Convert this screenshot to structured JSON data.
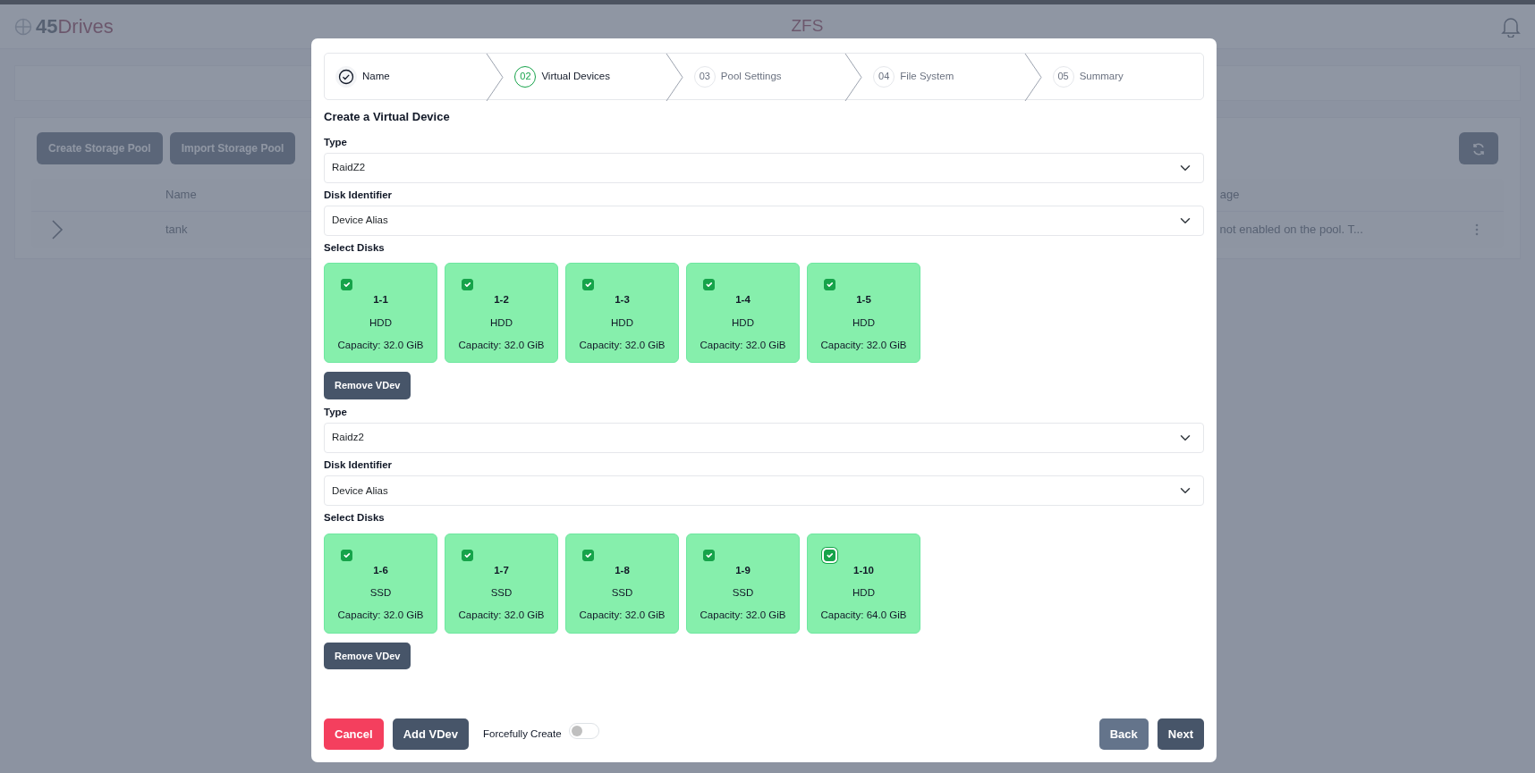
{
  "header": {
    "logo_text": "45Drives",
    "title": "ZFS"
  },
  "background": {
    "buttons": [
      "Create Storage Pool",
      "Import Storage Pool"
    ],
    "table": {
      "columns": [
        "Name",
        "age"
      ],
      "rows": [
        {
          "cells": [
            "tank",
            "not enabled on the pool. T..."
          ]
        }
      ]
    }
  },
  "modal": {
    "steps": [
      {
        "label": "Name",
        "completed": true,
        "selected": false
      },
      {
        "number": "02",
        "label": "Virtual Devices",
        "completed": false,
        "selected": true
      },
      {
        "number": "03",
        "label": "Pool Settings",
        "completed": false,
        "selected": false
      },
      {
        "number": "04",
        "label": "File System",
        "completed": false,
        "selected": false
      },
      {
        "number": "05",
        "label": "Summary",
        "completed": false,
        "selected": false
      }
    ],
    "heading": "Create a Virtual Device",
    "vdevs": [
      {
        "type_label": "Type",
        "type_value": "RaidZ2",
        "identifier_label": "Disk Identifier",
        "identifier_value": "Device Alias",
        "disks_label": "Select Disks",
        "remove_button": "Remove VDev",
        "disks": [
          {
            "name": "1-1",
            "media": "HDD",
            "capacity": "Capacity: 32.0 GiB",
            "checked": true,
            "focused": false
          },
          {
            "name": "1-2",
            "media": "HDD",
            "capacity": "Capacity: 32.0 GiB",
            "checked": true,
            "focused": false
          },
          {
            "name": "1-3",
            "media": "HDD",
            "capacity": "Capacity: 32.0 GiB",
            "checked": true,
            "focused": false
          },
          {
            "name": "1-4",
            "media": "HDD",
            "capacity": "Capacity: 32.0 GiB",
            "checked": true,
            "focused": false
          },
          {
            "name": "1-5",
            "media": "HDD",
            "capacity": "Capacity: 32.0 GiB",
            "checked": true,
            "focused": false
          }
        ]
      },
      {
        "type_label": "Type",
        "type_value": "Raidz2",
        "identifier_label": "Disk Identifier",
        "identifier_value": "Device Alias",
        "disks_label": "Select Disks",
        "remove_button": "Remove VDev",
        "disks": [
          {
            "name": "1-6",
            "media": "SSD",
            "capacity": "Capacity: 32.0 GiB",
            "checked": true,
            "focused": false
          },
          {
            "name": "1-7",
            "media": "SSD",
            "capacity": "Capacity: 32.0 GiB",
            "checked": true,
            "focused": false
          },
          {
            "name": "1-8",
            "media": "SSD",
            "capacity": "Capacity: 32.0 GiB",
            "checked": true,
            "focused": false
          },
          {
            "name": "1-9",
            "media": "SSD",
            "capacity": "Capacity: 32.0 GiB",
            "checked": true,
            "focused": false
          },
          {
            "name": "1-10",
            "media": "HDD",
            "capacity": "Capacity: 64.0 GiB",
            "checked": true,
            "focused": true
          }
        ]
      }
    ],
    "footer": {
      "cancel": "Cancel",
      "add": "Add VDev",
      "force_label": "Forcefully Create",
      "force_on": false,
      "back": "Back",
      "next": "Next"
    }
  }
}
